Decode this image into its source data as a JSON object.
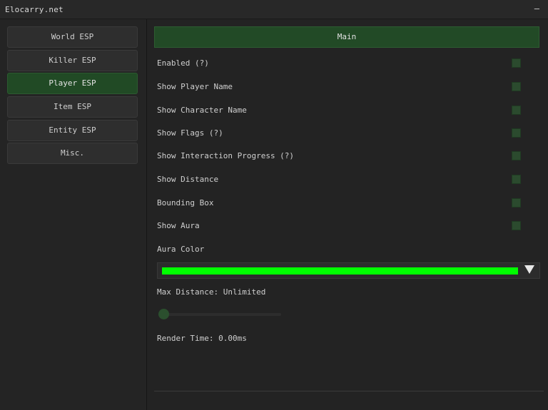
{
  "window": {
    "title": "Elocarry.net",
    "minimize_label": "–"
  },
  "sidebar": {
    "items": [
      {
        "label": "World ESP",
        "active": false
      },
      {
        "label": "Killer ESP",
        "active": false
      },
      {
        "label": "Player ESP",
        "active": true
      },
      {
        "label": "Item ESP",
        "active": false
      },
      {
        "label": "Entity ESP",
        "active": false
      },
      {
        "label": "Misc.",
        "active": false
      }
    ]
  },
  "main": {
    "header": "Main",
    "options": [
      {
        "label": "Enabled (?)",
        "checked": false
      },
      {
        "label": "Show Player Name",
        "checked": false
      },
      {
        "label": "Show Character Name",
        "checked": false
      },
      {
        "label": "Show Flags (?)",
        "checked": false
      },
      {
        "label": "Show Interaction Progress (?)",
        "checked": false
      },
      {
        "label": "Show Distance",
        "checked": false
      },
      {
        "label": "Bounding Box",
        "checked": false
      },
      {
        "label": "Show Aura",
        "checked": false
      }
    ],
    "aura_color_label": "Aura Color",
    "aura_color": "#00ff00",
    "max_distance_label": "Max Distance: Unlimited",
    "max_distance_fraction": 0.0,
    "render_time_label": "Render Time: 0.00ms"
  },
  "colors": {
    "accent": "#214a25",
    "background": "#232323",
    "checkbox": "#2b4a2e"
  }
}
